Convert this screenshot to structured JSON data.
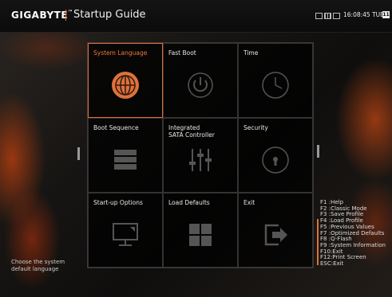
{
  "header": {
    "brand": "GIGABYTE",
    "brand_mark": "™",
    "title": "Startup Guide",
    "clock": "16:08:45 TUE",
    "clock_badge": "11",
    "system_icons": [
      "window-icon",
      "grid-icon",
      "square-icon"
    ]
  },
  "tiles": [
    {
      "label": "System Language",
      "icon": "globe-icon"
    },
    {
      "label": "Fast Boot",
      "icon": "power-icon"
    },
    {
      "label": "Time",
      "icon": "clock-icon"
    },
    {
      "label": "Boot Sequence",
      "icon": "stack-icon"
    },
    {
      "label": "Integrated\nSATA Controller",
      "icon": "sliders-icon"
    },
    {
      "label": "Security",
      "icon": "lock-icon"
    },
    {
      "label": "Start-up Options",
      "icon": "monitor-icon"
    },
    {
      "label": "Load Defaults",
      "icon": "windows-grid-icon"
    },
    {
      "label": "Exit",
      "icon": "exit-arrow-icon"
    }
  ],
  "selected_tile": "System Language",
  "hint": "Choose the system default language",
  "help": [
    "F1 :Help",
    "F2 :Classic Mode",
    "F3 :Save Profile",
    "F4 :Load Profile",
    "F5 :Previous Values",
    "F7 :Optimized Defaults",
    "F8 :Q-Flash",
    "F9 :System Information",
    "F10:Exit",
    "F12:Print Screen",
    "ESC:Exit"
  ],
  "colors": {
    "accent": "#e0703a",
    "background": "#0d0d0d"
  }
}
